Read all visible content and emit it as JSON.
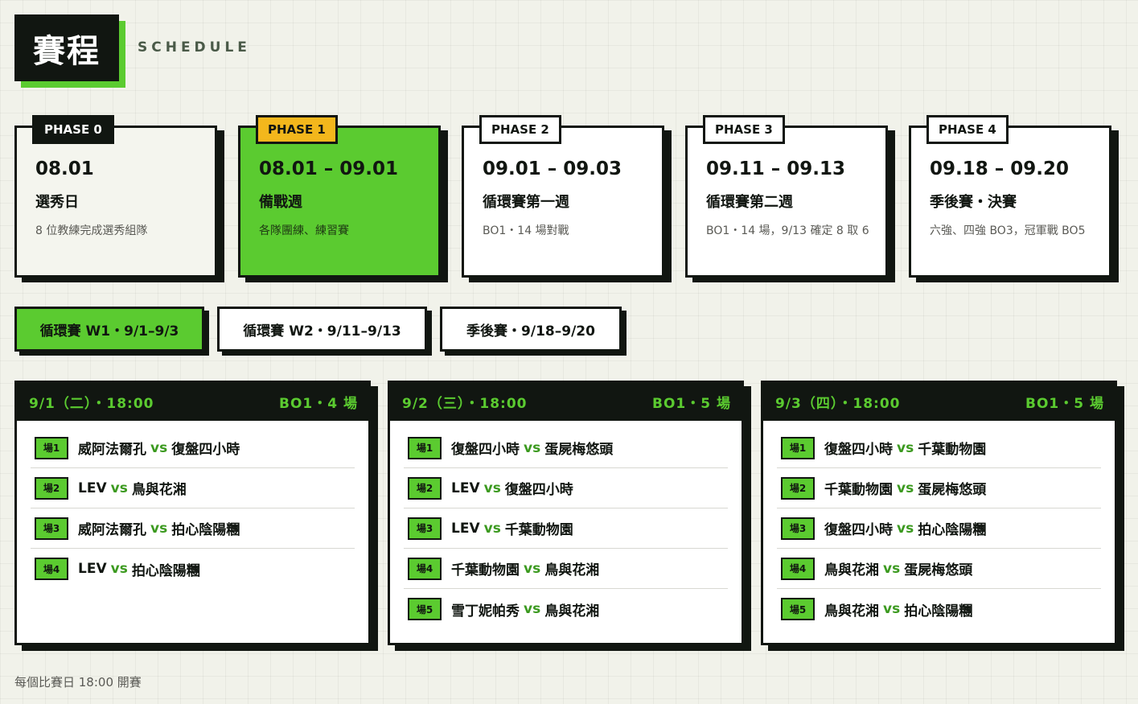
{
  "header": {
    "title": "賽程",
    "subtitle": "SCHEDULE"
  },
  "phases": [
    {
      "tag": "PHASE 0",
      "date": "08.01",
      "name": "選秀日",
      "desc": "8 位教練完成選秀組隊"
    },
    {
      "tag": "PHASE 1",
      "date": "08.01 – 09.01",
      "name": "備戰週",
      "desc": "各隊團練、練習賽"
    },
    {
      "tag": "PHASE 2",
      "date": "09.01 – 09.03",
      "name": "循環賽第一週",
      "desc": "BO1・14 場對戰"
    },
    {
      "tag": "PHASE 3",
      "date": "09.11 – 09.13",
      "name": "循環賽第二週",
      "desc": "BO1・14 場，9/13 確定 8 取 6"
    },
    {
      "tag": "PHASE 4",
      "date": "09.18 – 09.20",
      "name": "季後賽・決賽",
      "desc": "六強、四強 BO3，冠軍戰 BO5"
    }
  ],
  "tabs": [
    "循環賽 W1・9/1–9/3",
    "循環賽 W2・9/11–9/13",
    "季後賽・9/18–9/20"
  ],
  "vs_label": "vs",
  "days": [
    {
      "date": "9/1（二）・18:00",
      "format": "BO1・4 場",
      "matches": [
        {
          "badge": "場1",
          "a": "威阿法爾孔",
          "b": "復盤四小時"
        },
        {
          "badge": "場2",
          "a": "LEV",
          "b": "鳥與花湘"
        },
        {
          "badge": "場3",
          "a": "威阿法爾孔",
          "b": "拍心陰陽糰"
        },
        {
          "badge": "場4",
          "a": "LEV",
          "b": "拍心陰陽糰"
        }
      ]
    },
    {
      "date": "9/2（三）・18:00",
      "format": "BO1・5 場",
      "matches": [
        {
          "badge": "場1",
          "a": "復盤四小時",
          "b": "蛋屍梅悠頭"
        },
        {
          "badge": "場2",
          "a": "LEV",
          "b": "復盤四小時"
        },
        {
          "badge": "場3",
          "a": "LEV",
          "b": "千葉動物園"
        },
        {
          "badge": "場4",
          "a": "千葉動物園",
          "b": "鳥與花湘"
        },
        {
          "badge": "場5",
          "a": "雪丁妮帕秀",
          "b": "鳥與花湘"
        }
      ]
    },
    {
      "date": "9/3（四）・18:00",
      "format": "BO1・5 場",
      "matches": [
        {
          "badge": "場1",
          "a": "復盤四小時",
          "b": "千葉動物園"
        },
        {
          "badge": "場2",
          "a": "千葉動物園",
          "b": "蛋屍梅悠頭"
        },
        {
          "badge": "場3",
          "a": "復盤四小時",
          "b": "拍心陰陽糰"
        },
        {
          "badge": "場4",
          "a": "鳥與花湘",
          "b": "蛋屍梅悠頭"
        },
        {
          "badge": "場5",
          "a": "鳥與花湘",
          "b": "拍心陰陽糰"
        }
      ]
    }
  ],
  "footnote": "每個比賽日 18:00 開賽",
  "colors": {
    "accent": "#5bcb30",
    "dark": "#111611",
    "gold": "#f3b71c",
    "background": "#f1f2ea"
  }
}
